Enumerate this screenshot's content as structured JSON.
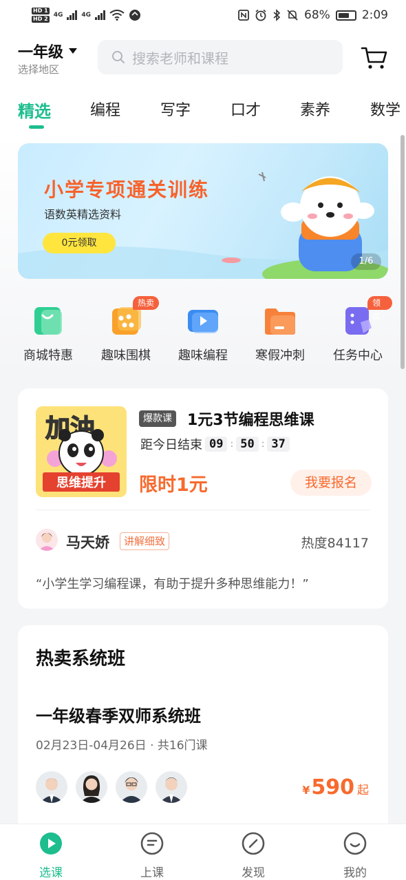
{
  "status_bar": {
    "hd1": "HD 1",
    "hd2": "HD 2",
    "net1": "4G",
    "net2": "4G",
    "battery": "68%",
    "time": "2:09"
  },
  "header": {
    "grade": "一年级",
    "region": "选择地区",
    "search_placeholder": "搜索老师和课程"
  },
  "tabs": [
    "精选",
    "编程",
    "写字",
    "口才",
    "素养",
    "数学"
  ],
  "banner": {
    "title": "小学专项通关训练",
    "subtitle": "语数英精选资料",
    "button": "0元领取",
    "page": "1/6"
  },
  "quick_entries": [
    {
      "label": "商城特惠",
      "icon": "shopping-bag-icon",
      "badge": ""
    },
    {
      "label": "趣味围棋",
      "icon": "go-board-icon",
      "badge": "热卖"
    },
    {
      "label": "趣味编程",
      "icon": "video-play-icon",
      "badge": ""
    },
    {
      "label": "寒假冲刺",
      "icon": "folder-icon",
      "badge": ""
    },
    {
      "label": "任务中心",
      "icon": "task-doc-icon",
      "badge": "领奖"
    }
  ],
  "course_card": {
    "poster_top": "加油",
    "poster_bottom": "思维提升",
    "tag": "爆款课",
    "title": "1元3节编程思维课",
    "countdown_label": "距今日结束",
    "hours": "09",
    "minutes": "50",
    "seconds": "37",
    "price": "限时1元",
    "signup": "我要报名",
    "teacher": "马天娇",
    "teacher_tag": "讲解细致",
    "heat": "热度84117",
    "quote": "“小学生学习编程课，有助于提升多种思维能力！”"
  },
  "hot_classes": {
    "section_title": "热卖系统班",
    "class_title": "一年级春季双师系统班",
    "dates": "02月23日-04月26日 · 共16门课",
    "currency": "¥",
    "price": "590",
    "price_suffix": "起"
  },
  "bottom_nav": [
    {
      "label": "选课",
      "icon": "play-circle-icon",
      "active": true
    },
    {
      "label": "上课",
      "icon": "class-icon",
      "active": false
    },
    {
      "label": "发现",
      "icon": "compass-icon",
      "active": false
    },
    {
      "label": "我的",
      "icon": "smile-icon",
      "active": false
    }
  ],
  "colors": {
    "accent": "#1dbd8e",
    "price": "#f76a2e",
    "badge": "#f5613c"
  }
}
